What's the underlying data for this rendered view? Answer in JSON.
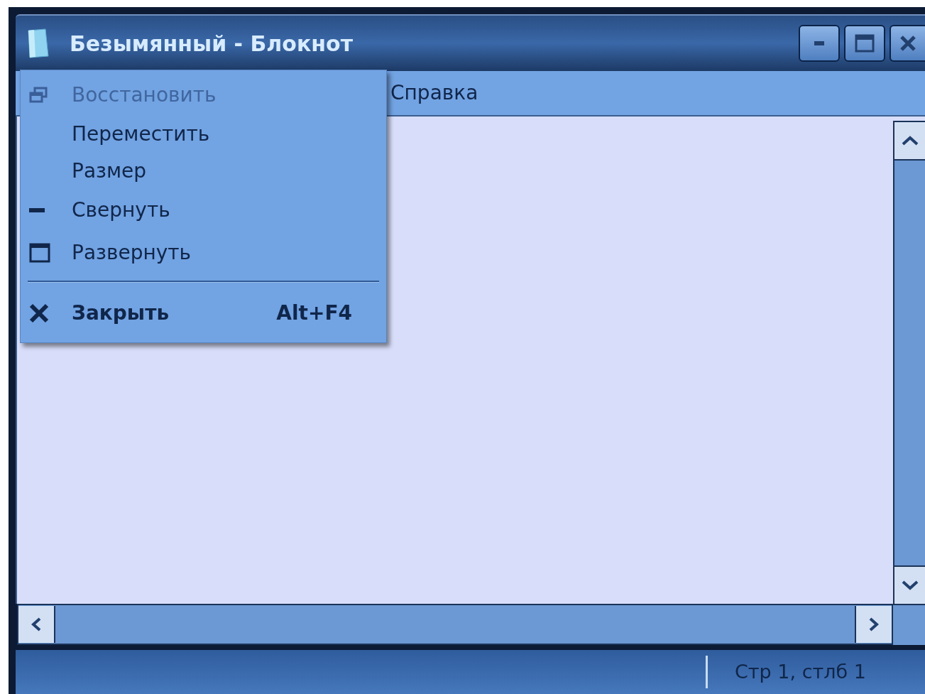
{
  "window": {
    "title": "Безымянный - Блокнот"
  },
  "menu_bar": {
    "items": [
      "Справка"
    ]
  },
  "system_menu": {
    "items": [
      {
        "kind": "restore",
        "label": "Восстановить",
        "disabled": true
      },
      {
        "kind": "plain",
        "label": "Переместить",
        "disabled": false
      },
      {
        "kind": "plain",
        "label": "Размер",
        "disabled": false
      },
      {
        "kind": "minimize",
        "label": "Свернуть",
        "disabled": false
      },
      {
        "kind": "maximize",
        "label": "Развернуть",
        "disabled": false
      },
      {
        "kind": "separator"
      },
      {
        "kind": "close",
        "label": "Закрыть",
        "shortcut": "Alt+F4",
        "disabled": false
      }
    ]
  },
  "status_bar": {
    "position": "Стр 1, стлб 1"
  }
}
